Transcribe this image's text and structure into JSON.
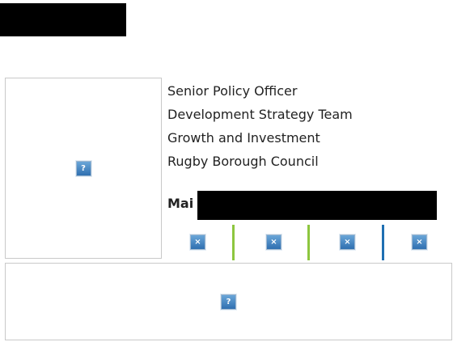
{
  "signature": {
    "lines": [
      "Senior Policy Officer",
      "Development Strategy Team",
      "Growth and Investment",
      "Rugby Borough Council"
    ],
    "mail_label": "Mai"
  },
  "icons": {
    "placeholder_glyph": "?",
    "social_glyph": "×"
  },
  "colors": {
    "separator_green": "#8dc63f",
    "separator_blue": "#1f6fb2"
  }
}
